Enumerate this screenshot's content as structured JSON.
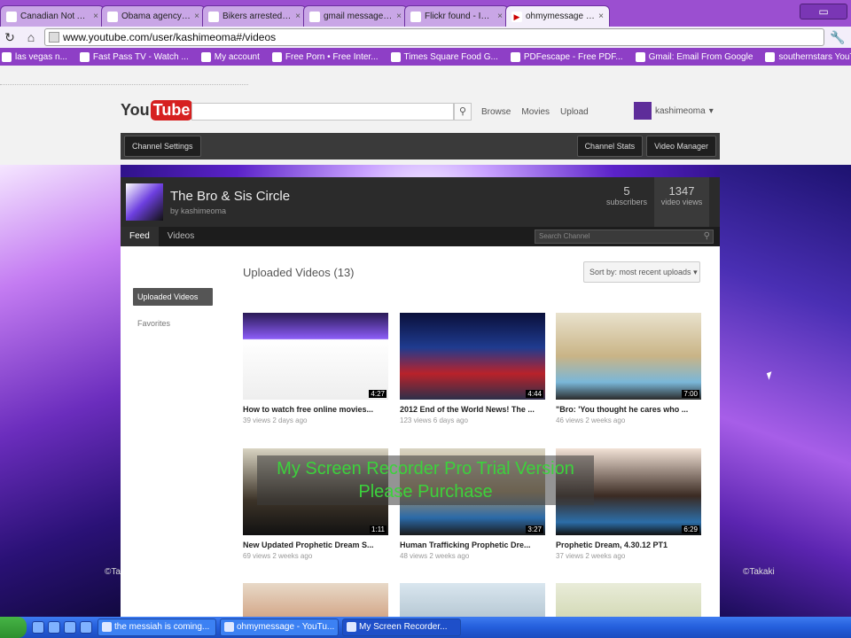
{
  "browser": {
    "tabs": [
      {
        "label": "Canadian Not Able In T",
        "active": false
      },
      {
        "label": "Obama agency rules Papist",
        "active": false
      },
      {
        "label": "Bikers arrested in Thailand",
        "active": false
      },
      {
        "label": "gmail messages - Google Sea",
        "active": false
      },
      {
        "label": "Flickr found - Internet messages",
        "active": false
      },
      {
        "label": "ohmymessage - YouTube",
        "active": true
      }
    ],
    "window_controls": "▭",
    "url": "www.youtube.com/user/kashimeoma#/videos",
    "bookmarks": [
      "las vegas n...",
      "Fast Pass TV - Watch ...",
      "My account",
      "Free Porn • Free Inter...",
      "Times Square Food G...",
      "PDFescape - Free PDF...",
      "Gmail: Email From Google",
      "southernstars YouTube"
    ]
  },
  "youtube": {
    "logo_you": "You",
    "logo_tube": "Tube",
    "search_placeholder": "",
    "nav": [
      "Browse",
      "Movies",
      "Upload"
    ],
    "username": "kashimeoma",
    "channel_settings": "Channel Settings",
    "channel_stats_btn": "Channel Stats",
    "video_manager_btn": "Video Manager",
    "channel_title": "The Bro & Sis Circle",
    "channel_by": "by kashimeoma",
    "stats": [
      {
        "number": "5",
        "label": "subscribers"
      },
      {
        "number": "1347",
        "label": "video views"
      }
    ],
    "tabs": [
      "Feed",
      "Videos"
    ],
    "channel_search_placeholder": "Search Channel",
    "sidebar": [
      "Uploaded Videos",
      "Favorites"
    ],
    "section_title": "Uploaded Videos (13)",
    "sort_label": "Sort by: most recent uploads",
    "videos": [
      {
        "title": "How to watch free online movies...",
        "meta": "39 views 2 days ago",
        "duration": "4:27"
      },
      {
        "title": "2012 End of the World News! The ...",
        "meta": "123 views 6 days ago",
        "duration": "4:44"
      },
      {
        "title": "\"Bro: 'You thought he cares who ...",
        "meta": "46 views 2 weeks ago",
        "duration": "7:00"
      },
      {
        "title": "New Updated Prophetic Dream S...",
        "meta": "69 views 2 weeks ago",
        "duration": "1:11"
      },
      {
        "title": "Human Trafficking Prophetic Dre...",
        "meta": "48 views 2 weeks ago",
        "duration": "3:27"
      },
      {
        "title": "Prophetic Dream, 4.30.12 PT1",
        "meta": "37 views 2 weeks ago",
        "duration": "6:29"
      },
      {
        "title": "",
        "meta": "",
        "duration": ""
      },
      {
        "title": "",
        "meta": "",
        "duration": ""
      },
      {
        "title": "",
        "meta": "",
        "duration": ""
      }
    ],
    "watermark_line1": "My Screen Recorder Pro Trial Version",
    "watermark_line2": "Please Purchase",
    "credit": "©Takaki"
  },
  "taskbar": {
    "start_label": "",
    "tasks": [
      {
        "label": "the messiah is coming...",
        "active": false
      },
      {
        "label": "ohmymessage - YouTu...",
        "active": false
      },
      {
        "label": "My Screen Recorder...",
        "active": true
      }
    ]
  }
}
